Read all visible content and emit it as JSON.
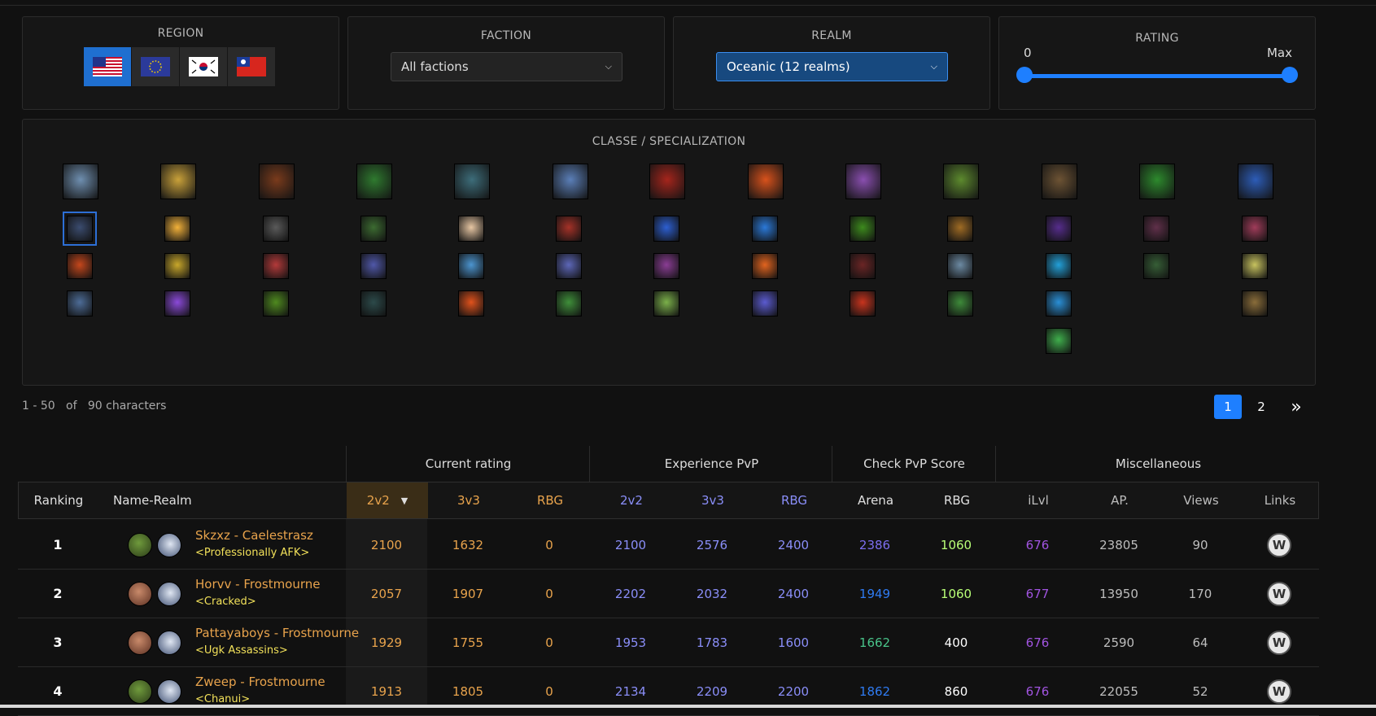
{
  "filters": {
    "region": {
      "title": "REGION",
      "flags": [
        "US",
        "EU",
        "KR",
        "TW"
      ],
      "selected": "US"
    },
    "faction": {
      "title": "FACTION",
      "value": "All factions"
    },
    "realm": {
      "title": "REALM",
      "value": "Oceanic (12 realms)"
    },
    "rating": {
      "title": "RATING",
      "min_label": "0",
      "max_label": "Max"
    }
  },
  "classes": {
    "title": "CLASSE / SPECIALIZATION",
    "class_icons": [
      "warrior-icon",
      "paladin-icon",
      "hunter-icon",
      "rogue-icon",
      "priest-icon",
      "death-knight-icon",
      "shaman-icon",
      "mage-icon",
      "warlock-icon",
      "monk-icon",
      "druid-icon",
      "demon-hunter-icon",
      "evoker-icon"
    ],
    "spec_colors": [
      [
        "#3b4c6f",
        "#f2b13a",
        "#5a5a5a",
        "#3c6b31",
        "#e7c6a3",
        "#a53228",
        "#2d5fd1",
        "#2b79d8",
        "#3d8a1d",
        "#9f6b24",
        "#562d8c",
        "#60304a",
        "#a03c5a"
      ],
      [
        "#c5471c",
        "#c8a72b",
        "#b33a3a",
        "#5058a9",
        "#4c95d0",
        "#5d67b8",
        "#8a3d94",
        "#e2641f",
        "#6b2525",
        "#6c8aa3",
        "#23a0d8",
        "#365e36",
        "#c7c25f"
      ],
      [
        "#4d6c97",
        "#8b4ad9",
        "#4f8a1f",
        "#2c4a4a",
        "#e0521c",
        "#3f8f3a",
        "#7bb04a",
        "#5b5bd0",
        "#c8341e",
        "#3e8b3a",
        "#2a8fd6",
        "",
        "#8a6d3a"
      ],
      [
        "",
        "",
        "",
        "",
        "",
        "",
        "",
        "",
        "",
        "",
        "#3fae4c",
        "",
        ""
      ]
    ]
  },
  "results": {
    "count_text": "1 - 50   of   90 characters",
    "pages": [
      "1",
      "2"
    ],
    "current_page": "1",
    "next_symbol": "»"
  },
  "table": {
    "groups": [
      "Current rating",
      "Experience PvP",
      "Check PvP Score",
      "Miscellaneous"
    ],
    "headers": [
      "Ranking",
      "Name-Realm",
      "2v2",
      "3v3",
      "RBG",
      "2v2",
      "3v3",
      "RBG",
      "Arena",
      "RBG",
      "iLvl",
      "AP.",
      "Views",
      "Links"
    ],
    "rows": [
      {
        "rank": "1",
        "name": "Skzxz - Caelestrasz",
        "guild": "<Professionally AFK>",
        "cur_2v2": "2100",
        "cur_3v3": "1632",
        "cur_rbg": "0",
        "exp_2v2": "2100",
        "exp_3v3": "2576",
        "exp_rbg": "2400",
        "score_arena": "2386",
        "score_rbg": "1060",
        "ilvl": "676",
        "ap": "23805",
        "views": "90",
        "race": "orc",
        "arena_color": "#7d6ef0",
        "rbg_color": "#b9ff77"
      },
      {
        "rank": "2",
        "name": "Horvv - Frostmourne",
        "guild": "<Cracked>",
        "cur_2v2": "2057",
        "cur_3v3": "1907",
        "cur_rbg": "0",
        "exp_2v2": "2202",
        "exp_3v3": "2032",
        "exp_rbg": "2400",
        "score_arena": "1949",
        "score_rbg": "1060",
        "ilvl": "677",
        "ap": "13950",
        "views": "170",
        "race": "human",
        "arena_color": "#2f7bf2",
        "rbg_color": "#b9ff77"
      },
      {
        "rank": "3",
        "name": "Pattayaboys - Frostmourne",
        "guild": "<Ugk Assassins>",
        "cur_2v2": "1929",
        "cur_3v3": "1755",
        "cur_rbg": "0",
        "exp_2v2": "1953",
        "exp_3v3": "1783",
        "exp_rbg": "1600",
        "score_arena": "1662",
        "score_rbg": "400",
        "ilvl": "676",
        "ap": "2590",
        "views": "64",
        "race": "human",
        "arena_color": "#49c48a",
        "rbg_color": "#ffffff"
      },
      {
        "rank": "4",
        "name": "Zweep - Frostmourne",
        "guild": "<Chanui>",
        "cur_2v2": "1913",
        "cur_3v3": "1805",
        "cur_rbg": "0",
        "exp_2v2": "2134",
        "exp_3v3": "2209",
        "exp_rbg": "2200",
        "score_arena": "1862",
        "score_rbg": "860",
        "ilvl": "676",
        "ap": "22055",
        "views": "52",
        "race": "orc",
        "arena_color": "#2f7bf2",
        "rbg_color": "#ffffff"
      }
    ]
  }
}
